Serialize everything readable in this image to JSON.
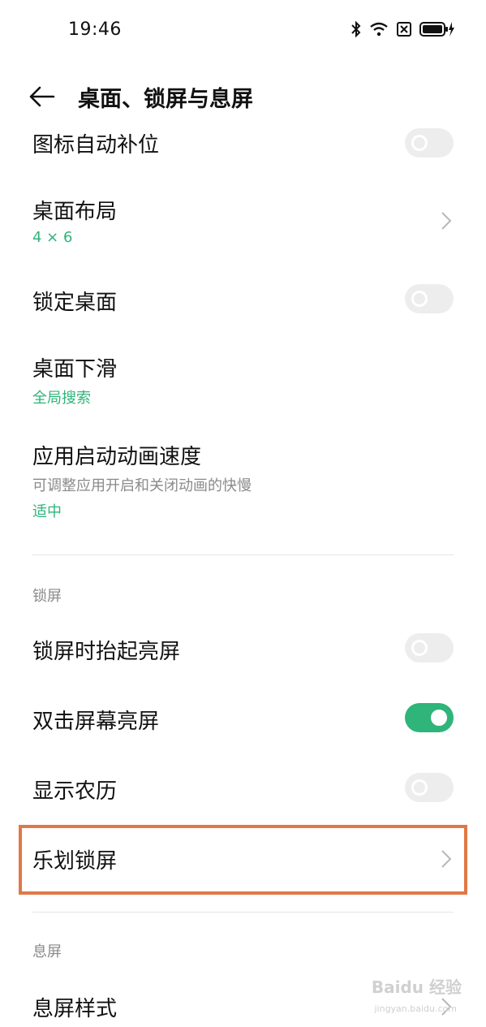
{
  "status_bar": {
    "time": "19:46"
  },
  "header": {
    "title": "桌面、锁屏与息屏"
  },
  "desktop_settings": [
    {
      "title": "图标自动补位",
      "control": "toggle",
      "on": false
    },
    {
      "title": "桌面布局",
      "value": "4 × 6",
      "control": "chevron"
    },
    {
      "title": "锁定桌面",
      "control": "toggle",
      "on": false
    },
    {
      "title": "桌面下滑",
      "value": "全局搜索"
    },
    {
      "title": "应用启动动画速度",
      "description": "可调整应用开启和关闭动画的快慢",
      "value": "适中"
    }
  ],
  "lock_screen_section": {
    "label": "锁屏",
    "items": [
      {
        "title": "锁屏时抬起亮屏",
        "control": "toggle",
        "on": false
      },
      {
        "title": "双击屏幕亮屏",
        "control": "toggle",
        "on": true
      },
      {
        "title": "显示农历",
        "control": "toggle",
        "on": false
      },
      {
        "title": "乐划锁屏",
        "control": "chevron"
      }
    ]
  },
  "aod_section": {
    "label": "息屏",
    "items": [
      {
        "title": "息屏样式",
        "control": "chevron"
      }
    ]
  },
  "watermark": {
    "text": "Baidu 经验",
    "sub": "jingyan.baidu.com"
  },
  "colors": {
    "accent": "#2fb47a",
    "highlight": "#e07846"
  }
}
